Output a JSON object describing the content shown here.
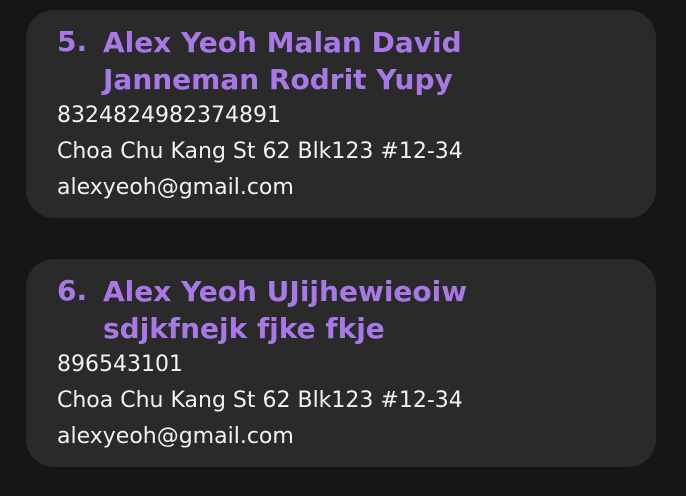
{
  "persons": [
    {
      "index": "5.",
      "name": "Alex Yeoh Malan David Janneman Rodrit Yupy",
      "phone": "8324824982374891",
      "address": "Choa Chu Kang St 62 Blk123 #12-34",
      "email": "alexyeoh@gmail.com"
    },
    {
      "index": "6.",
      "name": "Alex Yeoh UJijhewieoiw  sdjkfnejk fjke fkje",
      "phone": "896543101",
      "address": "Choa Chu Kang St 62 Blk123 #12-34",
      "email": "alexyeoh@gmail.com"
    }
  ],
  "colors": {
    "background": "#161616",
    "card": "#2a2a2a",
    "name": "#a879e6",
    "text": "#f2f2f2"
  }
}
